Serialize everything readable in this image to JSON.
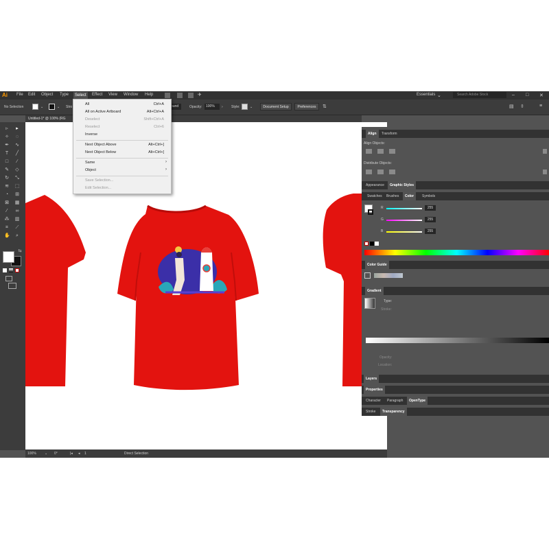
{
  "app": {
    "logo": "Ai"
  },
  "menubar": {
    "items": [
      "File",
      "Edit",
      "Object",
      "Type",
      "Select",
      "Effect",
      "View",
      "Window",
      "Help"
    ],
    "active": "Select",
    "workspace": "Essentials",
    "stock_placeholder": "Search Adobe Stock"
  },
  "controlbar": {
    "selection_label": "No Selection",
    "stroke_label": "Stro",
    "style_field": "ound",
    "opacity_label": "Opacity:",
    "opacity_value": "100%",
    "style_label": "Style:",
    "document_setup": "Document Setup",
    "preferences": "Preferences"
  },
  "document": {
    "tab_title": "Untitled-1* @ 100% (RG"
  },
  "select_menu": {
    "items": [
      {
        "label": "All",
        "shortcut": "Ctrl+A",
        "enabled": true
      },
      {
        "label": "All on Active Artboard",
        "shortcut": "Alt+Ctrl+A",
        "enabled": true
      },
      {
        "label": "Deselect",
        "shortcut": "Shift+Ctrl+A",
        "enabled": false
      },
      {
        "label": "Reselect",
        "shortcut": "Ctrl+6",
        "enabled": false
      },
      {
        "label": "Inverse",
        "shortcut": "",
        "enabled": true
      },
      {
        "label": "Next Object Above",
        "shortcut": "Alt+Ctrl+]",
        "enabled": true
      },
      {
        "label": "Next Object Below",
        "shortcut": "Alt+Ctrl+[",
        "enabled": true
      },
      {
        "label": "Same",
        "shortcut": "",
        "enabled": true,
        "submenu": true
      },
      {
        "label": "Object",
        "shortcut": "",
        "enabled": true,
        "submenu": true
      },
      {
        "label": "Save Selection...",
        "shortcut": "",
        "enabled": false
      },
      {
        "label": "Edit Selection...",
        "shortcut": "",
        "enabled": false
      }
    ]
  },
  "panels": {
    "align_tabs": [
      "Align",
      "Transform"
    ],
    "align_objects": "Align Objects:",
    "distribute_objects": "Distribute Objects:",
    "appearance_tabs": [
      "Appearance",
      "Graphic Styles"
    ],
    "swatch_tabs": [
      "Swatches",
      "Brushes",
      "Color",
      "Symbols"
    ],
    "color": {
      "channels": [
        {
          "name": "R",
          "value": "255",
          "color": "#ff3b30"
        },
        {
          "name": "G",
          "value": "255",
          "color": "#34c759"
        },
        {
          "name": "B",
          "value": "255",
          "color": "#4a6cff"
        }
      ]
    },
    "color_guide": "Color Guide",
    "gradient": "Gradient",
    "gradient_type_label": "Type:",
    "gradient_stroke_label": "Stroke:",
    "gradient_opacity_label": "Opacity:",
    "gradient_location_label": "Location:",
    "layers": "Layers",
    "properties": "Properties",
    "type_tabs": [
      "Character",
      "Paragraph",
      "OpenType"
    ],
    "stroke_tabs": [
      "Stroke",
      "Transparency"
    ]
  },
  "statusbar": {
    "zoom": "100%",
    "angle": "0°",
    "artboard": "1",
    "tool": "Direct Selection"
  },
  "colors": {
    "accent": "#ff9a00",
    "shirt": "#e3130f",
    "shirt_shadow": "#c10e0b",
    "chrome_dark": "#323232",
    "chrome": "#535353"
  }
}
